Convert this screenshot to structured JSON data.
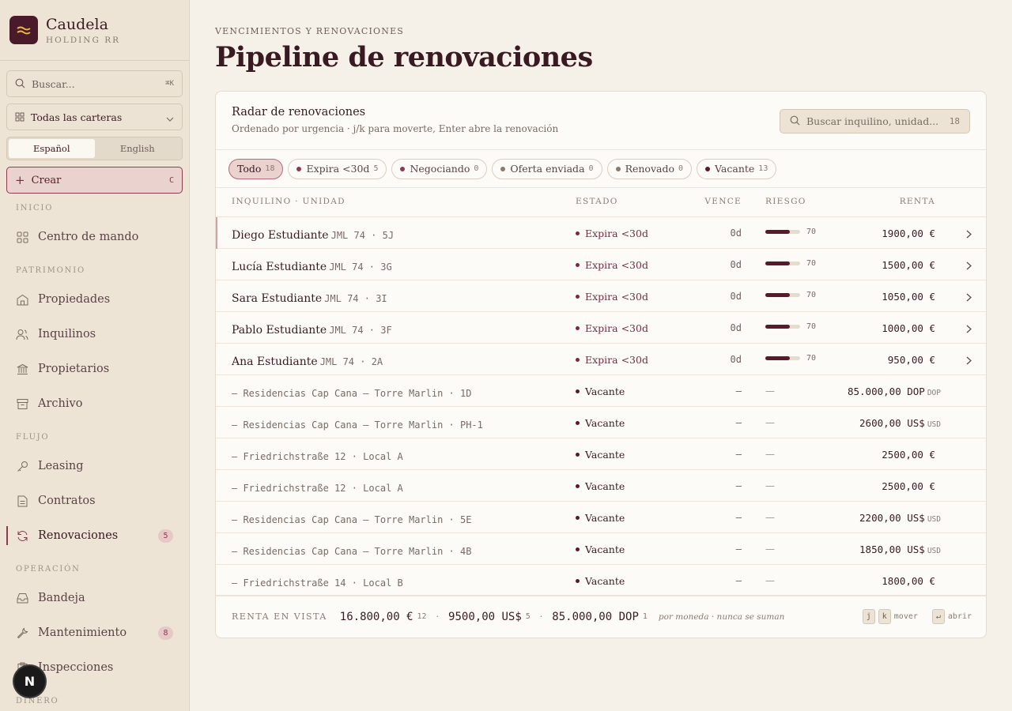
{
  "brand": {
    "name": "Caudela",
    "sub": "HOLDING RR"
  },
  "sidebar": {
    "search_placeholder": "Buscar...",
    "search_kbd": "⌘K",
    "portfolio": "Todas las carteras",
    "lang": [
      "Español",
      "English"
    ],
    "create": {
      "label": "Crear",
      "kbd": "C"
    },
    "sections": [
      "INICIO",
      "PATRIMONIO",
      "FLUJO",
      "OPERACIÓN",
      "DINERO"
    ],
    "items": [
      {
        "label": "Centro de mando"
      },
      {
        "label": "Propiedades"
      },
      {
        "label": "Inquilinos"
      },
      {
        "label": "Propietarios"
      },
      {
        "label": "Archivo"
      },
      {
        "label": "Leasing"
      },
      {
        "label": "Contratos"
      },
      {
        "label": "Renovaciones",
        "badge": "5"
      },
      {
        "label": "Bandeja"
      },
      {
        "label": "Mantenimiento",
        "badge": "8"
      },
      {
        "label": "Inspecciones"
      }
    ]
  },
  "header": {
    "eyebrow": "VENCIMIENTOS Y RENOVACIONES",
    "title": "Pipeline de renovaciones"
  },
  "card": {
    "title": "Radar de renovaciones",
    "subtitle": "Ordenado por urgencia · j/k para moverte, Enter abre la renovación",
    "search_placeholder": "Buscar inquilino, unidad...",
    "search_count": "18"
  },
  "filters": [
    {
      "label": "Todo",
      "count": "18",
      "color": ""
    },
    {
      "label": "Expira <30d",
      "count": "5",
      "color": "#8e3a50"
    },
    {
      "label": "Negociando",
      "count": "0",
      "color": "#8e3a50"
    },
    {
      "label": "Oferta enviada",
      "count": "0",
      "color": "#8a7a70"
    },
    {
      "label": "Renovado",
      "count": "0",
      "color": "#8a7a70"
    },
    {
      "label": "Vacante",
      "count": "13",
      "color": "#5a1a2c"
    }
  ],
  "columns": {
    "tenant": "INQUILINO · UNIDAD",
    "status": "ESTADO",
    "due": "VENCE",
    "risk": "RIESGO",
    "rent": "RENTA"
  },
  "rows": [
    {
      "name": "Diego Estudiante",
      "unit": "JML 74 · 5J",
      "status": "Expira <30d",
      "due": "0d",
      "risk": 70,
      "rent": "1900,00 €",
      "cur": ""
    },
    {
      "name": "Lucía Estudiante",
      "unit": "JML 74 · 3G",
      "status": "Expira <30d",
      "due": "0d",
      "risk": 70,
      "rent": "1500,00 €",
      "cur": ""
    },
    {
      "name": "Sara Estudiante",
      "unit": "JML 74 · 3I",
      "status": "Expira <30d",
      "due": "0d",
      "risk": 70,
      "rent": "1050,00 €",
      "cur": ""
    },
    {
      "name": "Pablo Estudiante",
      "unit": "JML 74 · 3F",
      "status": "Expira <30d",
      "due": "0d",
      "risk": 70,
      "rent": "1000,00 €",
      "cur": ""
    },
    {
      "name": "Ana Estudiante",
      "unit": "JML 74 · 2A",
      "status": "Expira <30d",
      "due": "0d",
      "risk": 70,
      "rent": "950,00 €",
      "cur": ""
    },
    {
      "name": "",
      "unit": "— Residencias Cap Cana — Torre Marlin · 1D",
      "status": "Vacante",
      "due": "—",
      "risk": "—",
      "rent": "85.000,00 DOP",
      "cur": "DOP"
    },
    {
      "name": "",
      "unit": "— Residencias Cap Cana — Torre Marlin · PH-1",
      "status": "Vacante",
      "due": "—",
      "risk": "—",
      "rent": "2600,00 US$",
      "cur": "USD"
    },
    {
      "name": "",
      "unit": "— Friedrichstraße 12 · Local A",
      "status": "Vacante",
      "due": "—",
      "risk": "—",
      "rent": "2500,00 €",
      "cur": ""
    },
    {
      "name": "",
      "unit": "— Friedrichstraße 12 · Local A",
      "status": "Vacante",
      "due": "—",
      "risk": "—",
      "rent": "2500,00 €",
      "cur": ""
    },
    {
      "name": "",
      "unit": "— Residencias Cap Cana — Torre Marlin · 5E",
      "status": "Vacante",
      "due": "—",
      "risk": "—",
      "rent": "2200,00 US$",
      "cur": "USD"
    },
    {
      "name": "",
      "unit": "— Residencias Cap Cana — Torre Marlin · 4B",
      "status": "Vacante",
      "due": "—",
      "risk": "—",
      "rent": "1850,00 US$",
      "cur": "USD"
    },
    {
      "name": "",
      "unit": "— Friedrichstraße 14 · Local B",
      "status": "Vacante",
      "due": "—",
      "risk": "—",
      "rent": "1800,00 €",
      "cur": ""
    }
  ],
  "footer": {
    "label": "RENTA EN VISTA",
    "totals": [
      {
        "amount": "16.800,00 €",
        "count": "12"
      },
      {
        "amount": "9500,00 US$",
        "count": "5"
      },
      {
        "amount": "85.000,00 DOP",
        "count": "1"
      }
    ],
    "separator": "·",
    "note": "por moneda · nunca se suman",
    "keys": {
      "j": "j",
      "k": "k",
      "move": "mover",
      "enter": "↵",
      "open": "abrir"
    }
  },
  "colors": {
    "accent": "#8e3a50",
    "brand": "#4a1a2a",
    "status_expiring": "#7a2a3e",
    "status_vacant": "#5a1a2c"
  },
  "icons": [
    "search-icon",
    "grid-icon",
    "chevron-down-icon",
    "plus-icon",
    "dashboard-icon",
    "building-icon",
    "users-icon",
    "bank-icon",
    "archive-icon",
    "key-icon",
    "document-icon",
    "refresh-icon",
    "inbox-icon",
    "wrench-icon",
    "clipboard-icon",
    "chevron-right-icon"
  ]
}
